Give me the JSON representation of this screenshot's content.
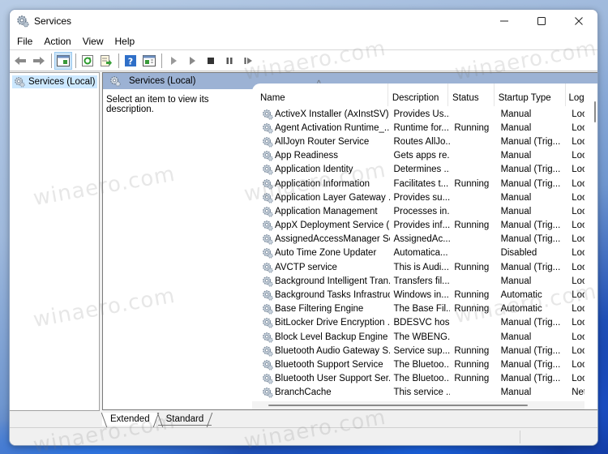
{
  "window": {
    "title": "Services",
    "controls": {
      "minimize": "–",
      "maximize": "☐",
      "close": "✕"
    }
  },
  "menu": [
    "File",
    "Action",
    "View",
    "Help"
  ],
  "toolbar": {
    "buttons": [
      "back-icon",
      "forward-icon",
      "show-hide-console-tree-icon",
      "refresh-icon",
      "export-list-icon",
      "help-icon",
      "properties-icon",
      "start-service-icon",
      "start-icon",
      "stop-icon",
      "pause-icon",
      "restart-icon"
    ]
  },
  "tree": {
    "items": [
      {
        "label": "Services (Local)",
        "selected": true
      }
    ]
  },
  "pane": {
    "header": "Services (Local)",
    "description_prompt": "Select an item to view its description."
  },
  "list": {
    "columns": [
      "Name",
      "Description",
      "Status",
      "Startup Type",
      "Log"
    ],
    "sort_indicator": "^",
    "rows": [
      {
        "name": "ActiveX Installer (AxInstSV)",
        "description": "Provides Us...",
        "status": "",
        "startup": "Manual",
        "logon": "Loca"
      },
      {
        "name": "Agent Activation Runtime_...",
        "description": "Runtime for...",
        "status": "Running",
        "startup": "Manual",
        "logon": "Loca"
      },
      {
        "name": "AllJoyn Router Service",
        "description": "Routes AllJo...",
        "status": "",
        "startup": "Manual (Trig...",
        "logon": "Loca"
      },
      {
        "name": "App Readiness",
        "description": "Gets apps re...",
        "status": "",
        "startup": "Manual",
        "logon": "Loca"
      },
      {
        "name": "Application Identity",
        "description": "Determines ...",
        "status": "",
        "startup": "Manual (Trig...",
        "logon": "Loca"
      },
      {
        "name": "Application Information",
        "description": "Facilitates t...",
        "status": "Running",
        "startup": "Manual (Trig...",
        "logon": "Loca"
      },
      {
        "name": "Application Layer Gateway ...",
        "description": "Provides su...",
        "status": "",
        "startup": "Manual",
        "logon": "Loca"
      },
      {
        "name": "Application Management",
        "description": "Processes in...",
        "status": "",
        "startup": "Manual",
        "logon": "Loca"
      },
      {
        "name": "AppX Deployment Service (...",
        "description": "Provides inf...",
        "status": "Running",
        "startup": "Manual (Trig...",
        "logon": "Loca"
      },
      {
        "name": "AssignedAccessManager Se...",
        "description": "AssignedAc...",
        "status": "",
        "startup": "Manual (Trig...",
        "logon": "Loca"
      },
      {
        "name": "Auto Time Zone Updater",
        "description": "Automatica...",
        "status": "",
        "startup": "Disabled",
        "logon": "Loca"
      },
      {
        "name": "AVCTP service",
        "description": "This is Audi...",
        "status": "Running",
        "startup": "Manual (Trig...",
        "logon": "Loca"
      },
      {
        "name": "Background Intelligent Tran...",
        "description": "Transfers fil...",
        "status": "",
        "startup": "Manual",
        "logon": "Loca"
      },
      {
        "name": "Background Tasks Infrastruc...",
        "description": "Windows in...",
        "status": "Running",
        "startup": "Automatic",
        "logon": "Loca"
      },
      {
        "name": "Base Filtering Engine",
        "description": "The Base Fil...",
        "status": "Running",
        "startup": "Automatic",
        "logon": "Loca"
      },
      {
        "name": "BitLocker Drive Encryption ...",
        "description": "BDESVC hos...",
        "status": "",
        "startup": "Manual (Trig...",
        "logon": "Loca"
      },
      {
        "name": "Block Level Backup Engine ...",
        "description": "The WBENG...",
        "status": "",
        "startup": "Manual",
        "logon": "Loca"
      },
      {
        "name": "Bluetooth Audio Gateway S...",
        "description": "Service sup...",
        "status": "Running",
        "startup": "Manual (Trig...",
        "logon": "Loca"
      },
      {
        "name": "Bluetooth Support Service",
        "description": "The Bluetoo...",
        "status": "Running",
        "startup": "Manual (Trig...",
        "logon": "Loca"
      },
      {
        "name": "Bluetooth User Support Ser...",
        "description": "The Bluetoo...",
        "status": "Running",
        "startup": "Manual (Trig...",
        "logon": "Loca"
      },
      {
        "name": "BranchCache",
        "description": "This service ...",
        "status": "",
        "startup": "Manual",
        "logon": "Netw"
      }
    ]
  },
  "tabs": [
    {
      "label": "Extended",
      "active": true
    },
    {
      "label": "Standard",
      "active": false
    }
  ],
  "watermark": "winaero.com"
}
